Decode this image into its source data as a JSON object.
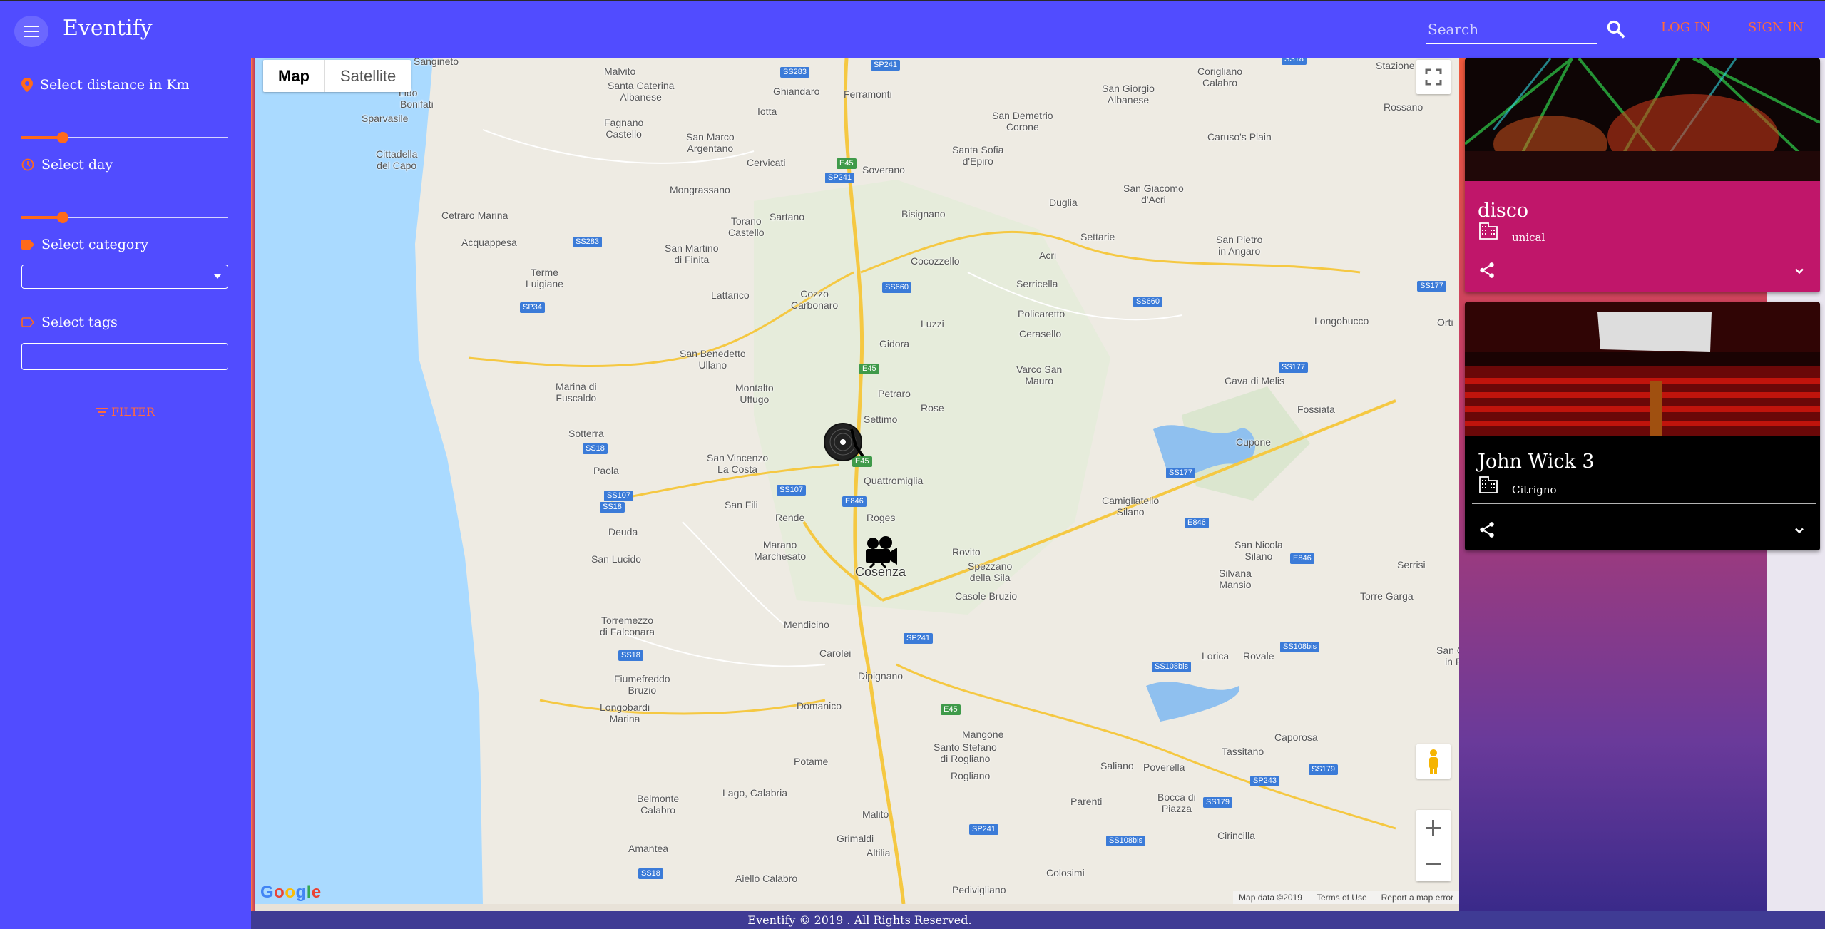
{
  "app": {
    "title": "Eventify"
  },
  "header": {
    "search_placeholder": "Search",
    "login_label": "LOG IN",
    "signin_label": "SIGN IN"
  },
  "sidebar": {
    "distance_label": "Select distance in Km",
    "distance_value": 0.2,
    "day_label": "Select day",
    "day_value": 0.2,
    "category_label": "Select category",
    "category_value": "",
    "tags_label": "Select tags",
    "tags_value": "",
    "filter_label": "FILTER"
  },
  "map": {
    "type_map": "Map",
    "type_satellite": "Satellite",
    "google": "Google",
    "attribution": [
      "Map data ©2019",
      "Terms of Use",
      "Report a map error"
    ],
    "places": [
      "Sangineto",
      "Malvito",
      "Santa Caterina Albanese",
      "Ghiandaro",
      "Ferramonti",
      "Lido",
      "Bonifati",
      "Iotta",
      "Sparvasile",
      "Fagnano Castello",
      "San Marco Argentano",
      "Cervicati",
      "Soverano",
      "Mongrassano",
      "Cittadella del Capo",
      "Cetraro Marina",
      "Acquappesa",
      "Torano Castello",
      "Sartano",
      "San Martino di Finita",
      "Terme Luigiane",
      "Lattarico",
      "Cozzo Carbonaro",
      "San Benedetto Ullano",
      "Marina di Fuscaldo",
      "Montalto Uffugo",
      "Sotterra",
      "Paola",
      "San Vincenzo La Costa",
      "San Fili",
      "Rende",
      "Roges",
      "Quattromiglia",
      "Settimo",
      "Deuda",
      "San Lucido",
      "Marano Marchesato",
      "Cosenza",
      "Torremezzo di Falconara",
      "Mendicino",
      "Carolei",
      "Fiumefreddo Bruzio",
      "Longobardi Marina",
      "Dipignano",
      "Domanico",
      "Potame",
      "Mangone",
      "Santo Stefano di Rogliano",
      "Rogliano",
      "Belmonte Calabro",
      "Lago, Calabria",
      "Malito",
      "Grimaldi",
      "Altilia",
      "Amantea",
      "Aiello Calabro",
      "Pedivigliano",
      "Colosimi",
      "Corigliano Calabro",
      "San Giorgio Albanese",
      "San Demetrio Corone",
      "Santa Sofia d'Epiro",
      "Caruso's Plain",
      "Rossano",
      "Bisignano",
      "Duglia",
      "San Giacomo d'Acri",
      "Settarie",
      "San Pietro in Angaro",
      "Cocozzello",
      "Acri",
      "Serricella",
      "Luzzi",
      "Policaretto",
      "Cerasello",
      "Longobucco",
      "Gidora",
      "Varco San Mauro",
      "Petraro",
      "Rose",
      "Cava di Melis",
      "Fossiata",
      "Cupone",
      "Camigliatello Silano",
      "San Nicola Silano",
      "Rovito",
      "Spezzano della Sila",
      "Casole Bruzio",
      "Silvana Mansio",
      "Torre Garga",
      "Serrisi",
      "Lorica",
      "Rovale",
      "San Gio in Fi",
      "Tassitano",
      "Caporosa",
      "Saliano",
      "Poverella",
      "Parenti",
      "Bocca di Piazza",
      "Cirincilla",
      "Stazione",
      "Orti"
    ],
    "shields": [
      "SS283",
      "SP241",
      "E45",
      "SP241",
      "SS283",
      "SS660",
      "E45",
      "SS660",
      "SS177",
      "SS177",
      "SP34",
      "SS18",
      "SS107",
      "SS18",
      "SS107",
      "E846",
      "E45",
      "E846",
      "E846",
      "SS177",
      "SS18",
      "SP241",
      "SS108bis",
      "SS108bis",
      "E45",
      "SS18",
      "SP241",
      "SS108bis",
      "SP243",
      "SS179",
      "SS179",
      "SS18"
    ]
  },
  "events": [
    {
      "title": "disco",
      "location": "unical",
      "color": "#c0166a"
    },
    {
      "title": "John Wick 3",
      "location": "Citrigno",
      "color": "#000000"
    }
  ],
  "footer": {
    "text": "Eventify © 2019 . All Rights Reserved."
  }
}
